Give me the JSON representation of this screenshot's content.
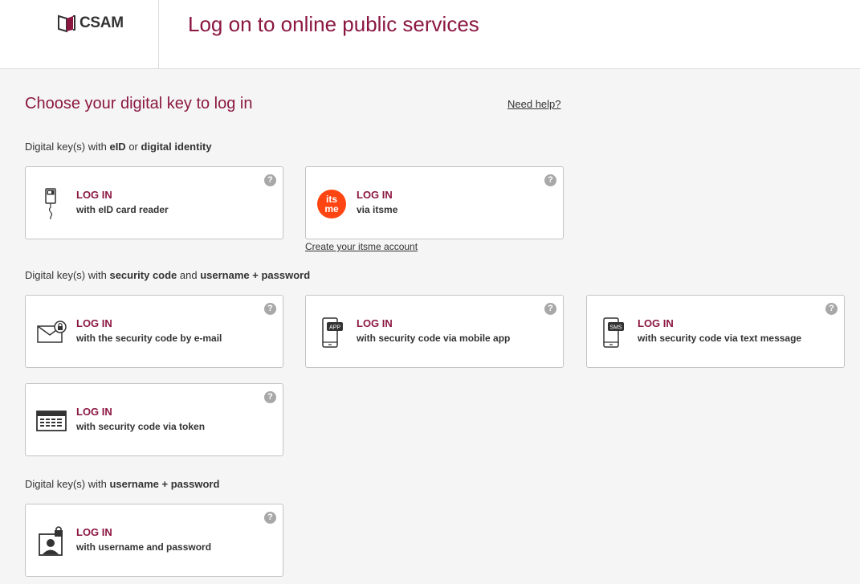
{
  "header": {
    "logo_text": "CSAM",
    "title": "Log on to online public services"
  },
  "main": {
    "heading": "Choose your digital key to log in",
    "help_link": "Need help?"
  },
  "sections": [
    {
      "prefix": "Digital key(s) with ",
      "bold1": "eID",
      "mid": " or ",
      "bold2": "digital identity",
      "mid2": "",
      "bold3": ""
    },
    {
      "prefix": "Digital key(s) with ",
      "bold1": "security code",
      "mid": " and ",
      "bold2": "username + password",
      "mid2": "",
      "bold3": ""
    },
    {
      "prefix": "Digital key(s) with ",
      "bold1": "username + password",
      "mid": "",
      "bold2": "",
      "mid2": "",
      "bold3": ""
    }
  ],
  "cards": {
    "eid": {
      "title": "LOG IN",
      "subtitle": "with eID card reader",
      "icon": "card-reader-icon"
    },
    "itsme": {
      "title": "LOG IN",
      "subtitle": "via itsme",
      "icon": "itsme-logo-icon",
      "logo_text_1": "its",
      "logo_text_2": "me"
    },
    "email": {
      "title": "LOG IN",
      "subtitle": "with the security code by e-mail",
      "icon": "envelope-lock-icon"
    },
    "app": {
      "title": "LOG IN",
      "subtitle": "with security code via mobile app",
      "icon": "phone-app-icon",
      "badge": "APP"
    },
    "sms": {
      "title": "LOG IN",
      "subtitle": "with security code via text message",
      "icon": "phone-sms-icon",
      "badge": "SMS"
    },
    "token": {
      "title": "LOG IN",
      "subtitle": "with security code via token",
      "icon": "token-icon"
    },
    "password": {
      "title": "LOG IN",
      "subtitle": "with username and password",
      "icon": "user-lock-icon"
    }
  },
  "itsme_link": "Create your itsme account",
  "help_icon_text": "?",
  "colors": {
    "accent": "#8b1741",
    "itsme": "#ff4612",
    "background": "#f5f5f5",
    "help_icon": "#a8a8a8"
  }
}
